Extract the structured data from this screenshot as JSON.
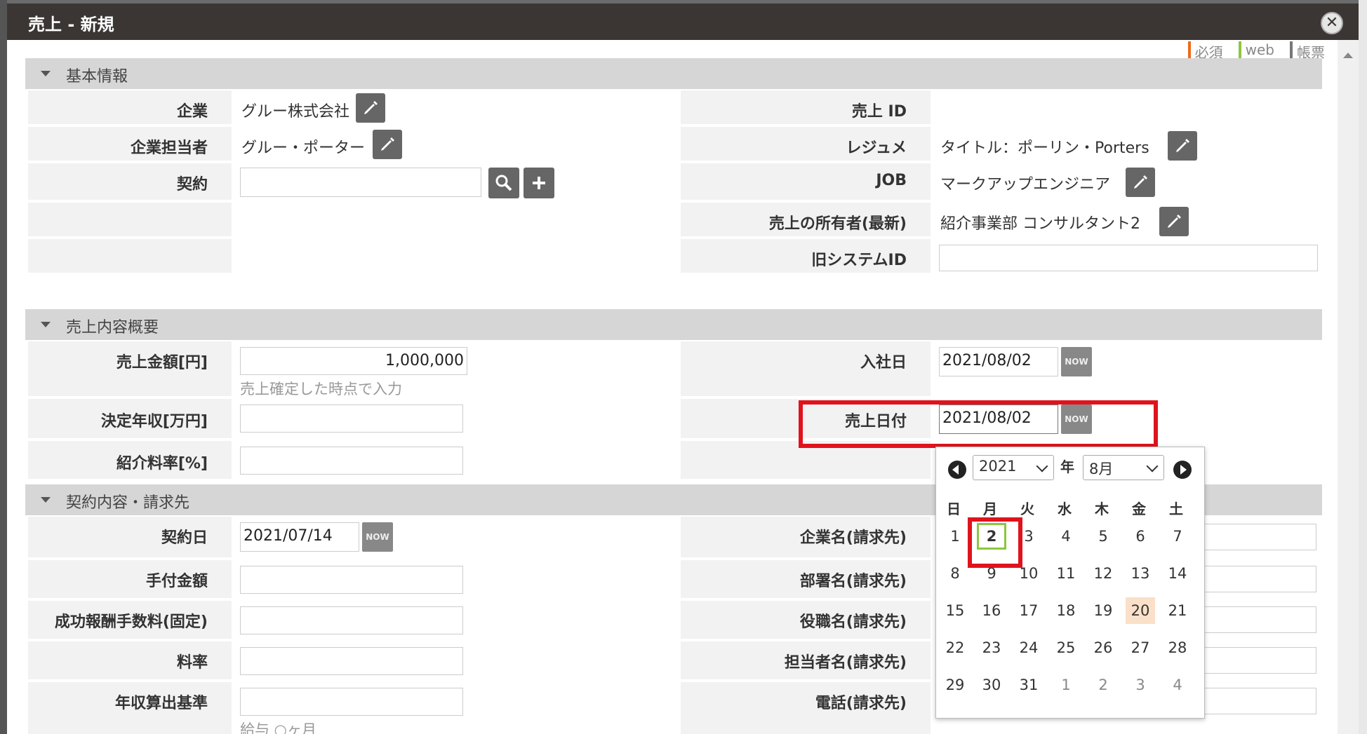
{
  "dialog": {
    "title": "売上 - 新規",
    "close_glyph": "✕"
  },
  "legend": {
    "required": "必須",
    "web": "web",
    "report": "帳票"
  },
  "sections": {
    "basic": "基本情報",
    "summary": "売上内容概要",
    "contract": "契約内容・請求先"
  },
  "basic": {
    "company_label": "企業",
    "company_value": "グルー株式会社",
    "contact_label": "企業担当者",
    "contact_value": "グルー・ポーター",
    "contract_label": "契約",
    "contract_value": "",
    "sales_id_label": "売上 ID",
    "resume_label": "レジュメ",
    "resume_value": "タイトル：ポーリン・Porters",
    "job_label": "JOB",
    "job_value": "マークアップエンジニア",
    "owner_label": "売上の所有者(最新)",
    "owner_value": "紹介事業部 コンサルタント2",
    "legacy_id_label": "旧システムID",
    "legacy_id_value": ""
  },
  "summary": {
    "amount_label": "売上金額[円]",
    "amount_value": "1,000,000",
    "amount_hint": "売上確定した時点で入力",
    "annual_label": "決定年収[万円]",
    "annual_value": "",
    "rate_label": "紹介料率[%]",
    "rate_value": "",
    "join_label": "入社日",
    "join_value": "2021/08/02",
    "sales_date_label": "売上日付",
    "sales_date_value": "2021/08/02",
    "now_label": "NOW"
  },
  "contract": {
    "date_label": "契約日",
    "date_value": "2021/07/14",
    "deposit_label": "手付金額",
    "fee_label": "成功報酬手数料(固定)",
    "rate_label": "料率",
    "basis_label": "年収算出基準",
    "basis_hint": "給与 ○ヶ月",
    "bill_company_label": "企業名(請求先)",
    "bill_dept_label": "部署名(請求先)",
    "bill_title_label": "役職名(請求先)",
    "bill_person_label": "担当者名(請求先)",
    "bill_phone_label": "電話(請求先)"
  },
  "calendar": {
    "year": "2021",
    "year_suffix": "年",
    "month": "8月",
    "weekdays": [
      "日",
      "月",
      "火",
      "水",
      "木",
      "金",
      "土"
    ],
    "days": [
      [
        "1",
        "2",
        "3",
        "4",
        "5",
        "6",
        "7"
      ],
      [
        "8",
        "9",
        "10",
        "11",
        "12",
        "13",
        "14"
      ],
      [
        "15",
        "16",
        "17",
        "18",
        "19",
        "20",
        "21"
      ],
      [
        "22",
        "23",
        "24",
        "25",
        "26",
        "27",
        "28"
      ],
      [
        "29",
        "30",
        "31",
        "1",
        "2",
        "3",
        "4"
      ]
    ],
    "selected_day": "2",
    "today_day": "20"
  },
  "colors": {
    "titlebar": "#3b3634",
    "highlight_red": "#e0131c",
    "selected_green": "#8dc63f",
    "today_bg": "#fae0c8"
  }
}
